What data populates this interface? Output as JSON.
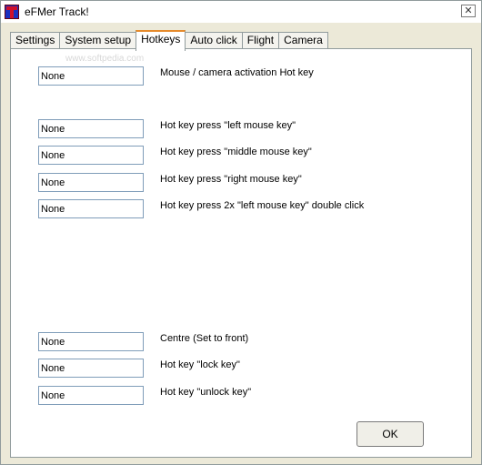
{
  "window": {
    "title": "eFMer Track!",
    "close_glyph": "✕"
  },
  "tabs": [
    "Settings",
    "System setup",
    "Hotkeys",
    "Auto click",
    "Flight",
    "Camera"
  ],
  "active_tab": "Hotkeys",
  "watermark": "www.softpedia.com",
  "hotkeys": [
    {
      "value": "None",
      "label": "Mouse / camera activation Hot key"
    },
    {
      "value": "None",
      "label": "Hot key press \"left mouse key\""
    },
    {
      "value": "None",
      "label": "Hot key press \"middle mouse key\""
    },
    {
      "value": "None",
      "label": "Hot key press \"right mouse key\""
    },
    {
      "value": "None",
      "label": "Hot key press 2x \"left  mouse key\" double click"
    },
    {
      "value": "None",
      "label": "Centre (Set to front)"
    },
    {
      "value": "None",
      "label": "Hot key \"lock key\""
    },
    {
      "value": "None",
      "label": "Hot key \"unlock key\""
    }
  ],
  "ok_button": "OK"
}
